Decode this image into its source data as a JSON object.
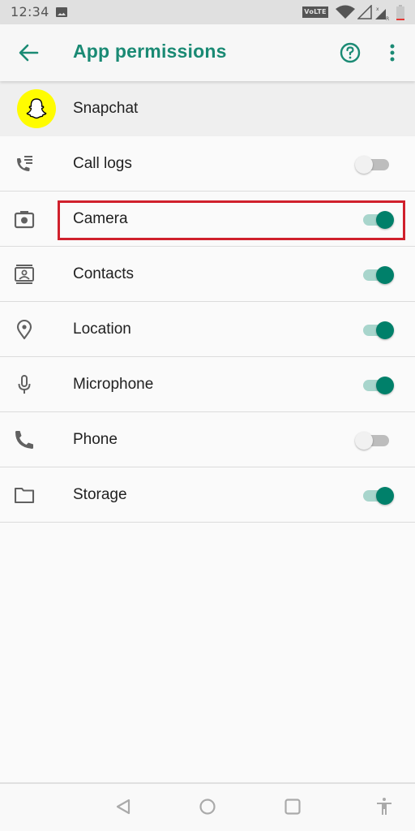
{
  "status_bar": {
    "time": "12:34",
    "volte_label": "Vo LTE",
    "icons": [
      "gallery-icon",
      "volte-icon",
      "wifi-icon",
      "signal-icon",
      "signal-roaming-icon",
      "battery-low-icon"
    ]
  },
  "app_bar": {
    "title": "App permissions",
    "back_icon": "arrow-back-icon",
    "help_icon": "help-circle-icon",
    "more_icon": "more-vert-icon"
  },
  "app": {
    "name": "Snapchat",
    "logo_color": "#fffc00"
  },
  "permissions": [
    {
      "label": "Call logs",
      "icon": "call-log-icon",
      "enabled": false
    },
    {
      "label": "Camera",
      "icon": "camera-icon",
      "enabled": true,
      "highlighted": true
    },
    {
      "label": "Contacts",
      "icon": "contacts-icon",
      "enabled": true
    },
    {
      "label": "Location",
      "icon": "location-icon",
      "enabled": true
    },
    {
      "label": "Microphone",
      "icon": "microphone-icon",
      "enabled": true
    },
    {
      "label": "Phone",
      "icon": "phone-icon",
      "enabled": false
    },
    {
      "label": "Storage",
      "icon": "folder-icon",
      "enabled": true
    }
  ],
  "nav_bar": {
    "buttons": [
      "back-triangle-icon",
      "home-circle-icon",
      "recents-square-icon",
      "accessibility-icon"
    ]
  },
  "colors": {
    "accent": "#1a8a74",
    "toggle_on": "#00806a",
    "highlight_border": "#d0202c"
  }
}
